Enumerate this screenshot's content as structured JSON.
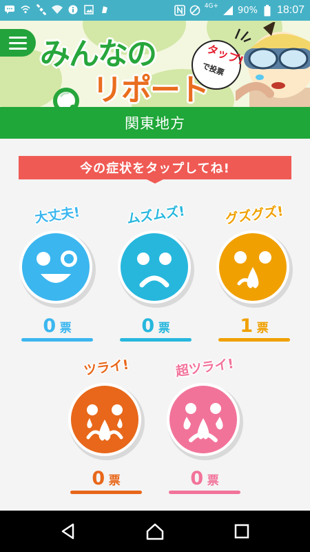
{
  "status_bar": {
    "battery": "90%",
    "network": "4G+",
    "time": "18:07"
  },
  "banner": {
    "logo_line1": "みんなの",
    "logo_line2": "リポート",
    "tap_line1": "タップ!",
    "tap_line2": "で投票"
  },
  "region": {
    "title": "関東地方"
  },
  "instruction": "今の症状をタップしてね!",
  "unit": "票",
  "symptoms": [
    {
      "label": "大丈夫!",
      "count": "0",
      "color": "#3bb6ef"
    },
    {
      "label": "ムズムズ!",
      "count": "0",
      "color": "#27b7dd"
    },
    {
      "label": "グズグズ!",
      "count": "1",
      "color": "#f0a000"
    },
    {
      "label": "ツライ!",
      "count": "0",
      "color": "#e8671a"
    },
    {
      "label": "超ツライ!",
      "count": "0",
      "color": "#f2739a"
    }
  ],
  "colors": {
    "status_bar": "#45b1c6",
    "region_bar": "#1fa739",
    "ribbon": "#f05a54"
  }
}
